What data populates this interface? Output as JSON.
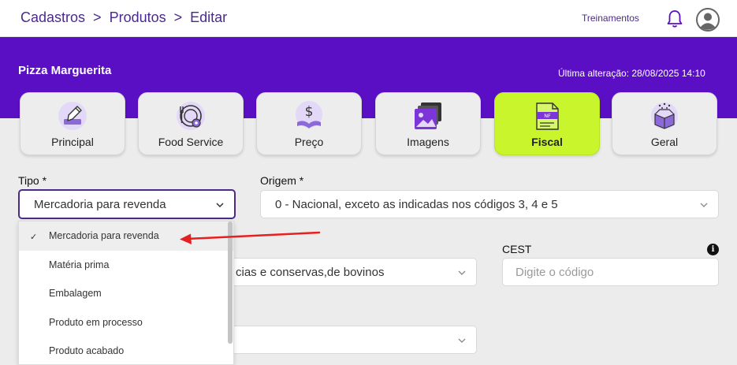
{
  "header": {
    "breadcrumbs": [
      "Cadastros",
      "Produtos",
      "Editar"
    ],
    "separator": ">",
    "training_link": "Treinamentos",
    "icons": [
      "bell-icon",
      "user-avatar-icon"
    ]
  },
  "product": {
    "name": "Pizza Marguerita",
    "last_change": "Última alteração: 28/08/2025 14:10"
  },
  "tabs": [
    {
      "label": "Principal",
      "icon": "pencil-edit-icon",
      "active": false
    },
    {
      "label": "Food Service",
      "icon": "plate-gear-icon",
      "active": false
    },
    {
      "label": "Preço",
      "icon": "dollar-hand-icon",
      "active": false
    },
    {
      "label": "Imagens",
      "icon": "images-icon",
      "active": false
    },
    {
      "label": "Fiscal",
      "icon": "nf-document-icon",
      "active": true
    },
    {
      "label": "Geral",
      "icon": "box-sparkle-icon",
      "active": false
    }
  ],
  "form": {
    "tipo_label": "Tipo *",
    "tipo_value": "Mercadoria para revenda",
    "origem_label": "Origem *",
    "origem_value": "0 - Nacional, exceto as indicadas nos códigos 3, 4 e 5",
    "ncm_value": "cias e conservas,de bovinos",
    "cest_label": "CEST",
    "cest_placeholder": "Digite o código",
    "info_glyph": "i"
  },
  "dropdown": {
    "options": [
      "Mercadoria para revenda",
      "Matéria prima",
      "Embalagem",
      "Produto em processo",
      "Produto acabado"
    ],
    "selected": "Mercadoria para revenda",
    "check_glyph": "✓"
  },
  "colors": {
    "brand_purple": "#5a0fc4",
    "breadcrumb_purple": "#4b2a8a",
    "active_tab": "#c9f52d",
    "arrow_red": "#e52020"
  }
}
